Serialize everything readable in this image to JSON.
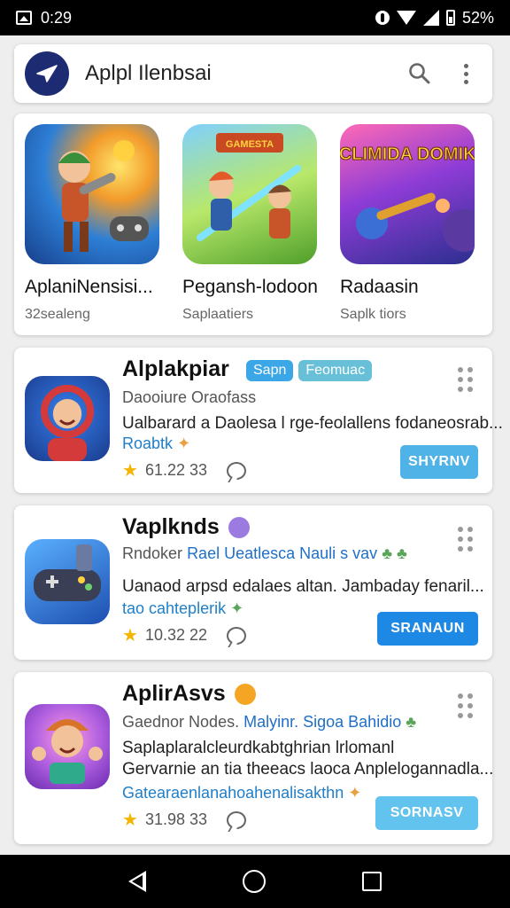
{
  "status_bar": {
    "time": "0:29",
    "battery": "52%"
  },
  "app_bar": {
    "title": "Aplpl Ilenbsai"
  },
  "featured": [
    {
      "name": "AplaniNensisi...",
      "subtitle": "32sealeng"
    },
    {
      "name": "Pegansh-lodoon",
      "subtitle": "Saplaatiers"
    },
    {
      "name": "Radaasin",
      "subtitle": "Saplk tiors"
    }
  ],
  "featured_art_text": {
    "second": "GAMESTA",
    "third": "ACLIMIDA DOMIKON"
  },
  "cards": [
    {
      "title": "Alplakpiar",
      "chips": [
        "Sapn",
        "Feomuac"
      ],
      "subtitle": "Daooiure Oraofass",
      "subtitle_highlight": "",
      "description": [
        "Ualbarard a Daolesa l rge-feolallens fodaneosrab..."
      ],
      "link": "Roabtk",
      "rating": "61.22 33",
      "action": "SHYRNV",
      "action_color": "#4fb3e8"
    },
    {
      "title": "Vaplknds",
      "chips": [],
      "subtitle": "Rndoker",
      "subtitle_highlight": "Rael Ueatlesca Nauli s vav",
      "description": [
        "Uanaod arpsd edalaes altan. Jambaday fenaril..."
      ],
      "link": "tao cahteplerik",
      "rating": "10.32 22",
      "action": "SRANAUN",
      "action_color": "#1e88e5"
    },
    {
      "title": "AplirAsvs",
      "chips": [],
      "subtitle": "Gaednor Nodes.",
      "subtitle_highlight": "Malyinr. Sigoa Bahidio",
      "description": [
        "Saplaplaralcleurdkabtghrian lrlomanl",
        "Gervarnie an tia theeacs laoca Anplelogannadla..."
      ],
      "link": "Gatearaenlanahoahenalisakthn",
      "rating": "31.98 33",
      "action": "SORNASV",
      "action_color": "#62c3ee"
    }
  ]
}
